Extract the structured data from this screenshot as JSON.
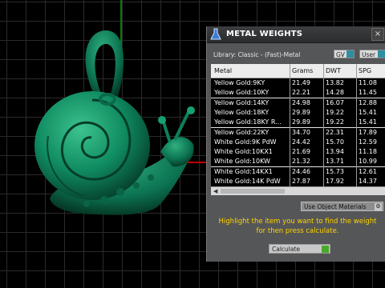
{
  "panel": {
    "title": "METAL WEIGHTS",
    "close_label": "×",
    "library": "Library: Classic - (Fast)-Metal",
    "gv_select": "GV",
    "user_select": "User",
    "material_select": "Use Object Materials",
    "hint": "Highlight the item you want to find the weight for then press calculate.",
    "calculate_label": "Calculate"
  },
  "table": {
    "columns": [
      "Metal",
      "Grams",
      "DWT",
      "SPG"
    ],
    "rows": [
      [
        "Yellow Gold:9KY",
        "21.49",
        "13.82",
        "11.08"
      ],
      [
        "Yellow Gold:10KY",
        "22.21",
        "14.28",
        "11.45"
      ],
      [
        "Yellow Gold:14KY",
        "24.98",
        "16.07",
        "12.88"
      ],
      [
        "Yellow Gold:18KY",
        "29.89",
        "19.22",
        "15.41"
      ],
      [
        "Yellow Gold:18KY R...",
        "29.89",
        "19.22",
        "15.41"
      ],
      [
        "Yellow Gold:22KY",
        "34.70",
        "22.31",
        "17.89"
      ],
      [
        "White Gold:9K PdW",
        "24.42",
        "15.70",
        "12.59"
      ],
      [
        "White Gold:10KX1",
        "21.69",
        "13.94",
        "11.18"
      ],
      [
        "White Gold:10KW",
        "21.32",
        "13.71",
        "10.99"
      ],
      [
        "White Gold:14KX1",
        "24.46",
        "15.73",
        "12.61"
      ],
      [
        "White Gold:14K PdW",
        "27.87",
        "17.92",
        "14.37"
      ]
    ]
  },
  "colors": {
    "model": "#0d7f5c",
    "hint": "#ffd400"
  }
}
